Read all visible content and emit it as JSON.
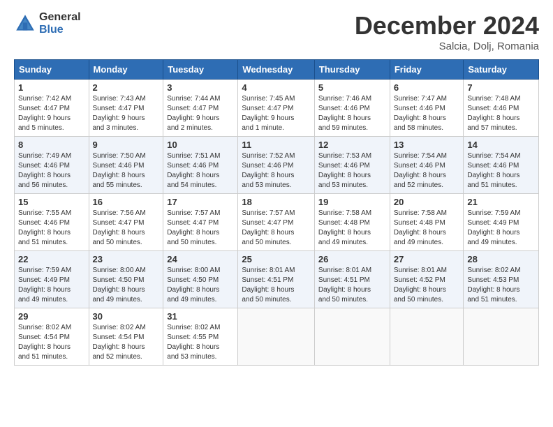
{
  "logo": {
    "general": "General",
    "blue": "Blue"
  },
  "title": {
    "month": "December 2024",
    "location": "Salcia, Dolj, Romania"
  },
  "headers": [
    "Sunday",
    "Monday",
    "Tuesday",
    "Wednesday",
    "Thursday",
    "Friday",
    "Saturday"
  ],
  "weeks": [
    [
      {
        "day": "1",
        "info": "Sunrise: 7:42 AM\nSunset: 4:47 PM\nDaylight: 9 hours\nand 5 minutes."
      },
      {
        "day": "2",
        "info": "Sunrise: 7:43 AM\nSunset: 4:47 PM\nDaylight: 9 hours\nand 3 minutes."
      },
      {
        "day": "3",
        "info": "Sunrise: 7:44 AM\nSunset: 4:47 PM\nDaylight: 9 hours\nand 2 minutes."
      },
      {
        "day": "4",
        "info": "Sunrise: 7:45 AM\nSunset: 4:47 PM\nDaylight: 9 hours\nand 1 minute."
      },
      {
        "day": "5",
        "info": "Sunrise: 7:46 AM\nSunset: 4:46 PM\nDaylight: 8 hours\nand 59 minutes."
      },
      {
        "day": "6",
        "info": "Sunrise: 7:47 AM\nSunset: 4:46 PM\nDaylight: 8 hours\nand 58 minutes."
      },
      {
        "day": "7",
        "info": "Sunrise: 7:48 AM\nSunset: 4:46 PM\nDaylight: 8 hours\nand 57 minutes."
      }
    ],
    [
      {
        "day": "8",
        "info": "Sunrise: 7:49 AM\nSunset: 4:46 PM\nDaylight: 8 hours\nand 56 minutes."
      },
      {
        "day": "9",
        "info": "Sunrise: 7:50 AM\nSunset: 4:46 PM\nDaylight: 8 hours\nand 55 minutes."
      },
      {
        "day": "10",
        "info": "Sunrise: 7:51 AM\nSunset: 4:46 PM\nDaylight: 8 hours\nand 54 minutes."
      },
      {
        "day": "11",
        "info": "Sunrise: 7:52 AM\nSunset: 4:46 PM\nDaylight: 8 hours\nand 53 minutes."
      },
      {
        "day": "12",
        "info": "Sunrise: 7:53 AM\nSunset: 4:46 PM\nDaylight: 8 hours\nand 53 minutes."
      },
      {
        "day": "13",
        "info": "Sunrise: 7:54 AM\nSunset: 4:46 PM\nDaylight: 8 hours\nand 52 minutes."
      },
      {
        "day": "14",
        "info": "Sunrise: 7:54 AM\nSunset: 4:46 PM\nDaylight: 8 hours\nand 51 minutes."
      }
    ],
    [
      {
        "day": "15",
        "info": "Sunrise: 7:55 AM\nSunset: 4:46 PM\nDaylight: 8 hours\nand 51 minutes."
      },
      {
        "day": "16",
        "info": "Sunrise: 7:56 AM\nSunset: 4:47 PM\nDaylight: 8 hours\nand 50 minutes."
      },
      {
        "day": "17",
        "info": "Sunrise: 7:57 AM\nSunset: 4:47 PM\nDaylight: 8 hours\nand 50 minutes."
      },
      {
        "day": "18",
        "info": "Sunrise: 7:57 AM\nSunset: 4:47 PM\nDaylight: 8 hours\nand 50 minutes."
      },
      {
        "day": "19",
        "info": "Sunrise: 7:58 AM\nSunset: 4:48 PM\nDaylight: 8 hours\nand 49 minutes."
      },
      {
        "day": "20",
        "info": "Sunrise: 7:58 AM\nSunset: 4:48 PM\nDaylight: 8 hours\nand 49 minutes."
      },
      {
        "day": "21",
        "info": "Sunrise: 7:59 AM\nSunset: 4:49 PM\nDaylight: 8 hours\nand 49 minutes."
      }
    ],
    [
      {
        "day": "22",
        "info": "Sunrise: 7:59 AM\nSunset: 4:49 PM\nDaylight: 8 hours\nand 49 minutes."
      },
      {
        "day": "23",
        "info": "Sunrise: 8:00 AM\nSunset: 4:50 PM\nDaylight: 8 hours\nand 49 minutes."
      },
      {
        "day": "24",
        "info": "Sunrise: 8:00 AM\nSunset: 4:50 PM\nDaylight: 8 hours\nand 49 minutes."
      },
      {
        "day": "25",
        "info": "Sunrise: 8:01 AM\nSunset: 4:51 PM\nDaylight: 8 hours\nand 50 minutes."
      },
      {
        "day": "26",
        "info": "Sunrise: 8:01 AM\nSunset: 4:51 PM\nDaylight: 8 hours\nand 50 minutes."
      },
      {
        "day": "27",
        "info": "Sunrise: 8:01 AM\nSunset: 4:52 PM\nDaylight: 8 hours\nand 50 minutes."
      },
      {
        "day": "28",
        "info": "Sunrise: 8:02 AM\nSunset: 4:53 PM\nDaylight: 8 hours\nand 51 minutes."
      }
    ],
    [
      {
        "day": "29",
        "info": "Sunrise: 8:02 AM\nSunset: 4:54 PM\nDaylight: 8 hours\nand 51 minutes."
      },
      {
        "day": "30",
        "info": "Sunrise: 8:02 AM\nSunset: 4:54 PM\nDaylight: 8 hours\nand 52 minutes."
      },
      {
        "day": "31",
        "info": "Sunrise: 8:02 AM\nSunset: 4:55 PM\nDaylight: 8 hours\nand 53 minutes."
      },
      null,
      null,
      null,
      null
    ]
  ]
}
